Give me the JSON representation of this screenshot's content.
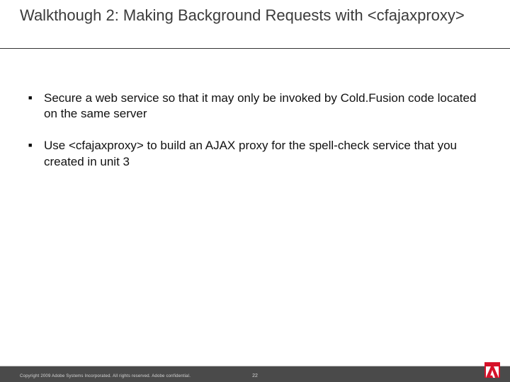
{
  "title": "Walkthough 2: Making Background Requests with <cfajaxproxy>",
  "bullets": [
    "Secure a web service so that it may only be invoked by Cold.Fusion code located on the same server",
    "Use <cfajaxproxy> to build an AJAX proxy for the spell-check service that you created in unit 3"
  ],
  "footer": {
    "copyright": "Copyright 2009 Adobe Systems Incorporated.  All rights reserved.  Adobe confidential.",
    "page": "22"
  }
}
